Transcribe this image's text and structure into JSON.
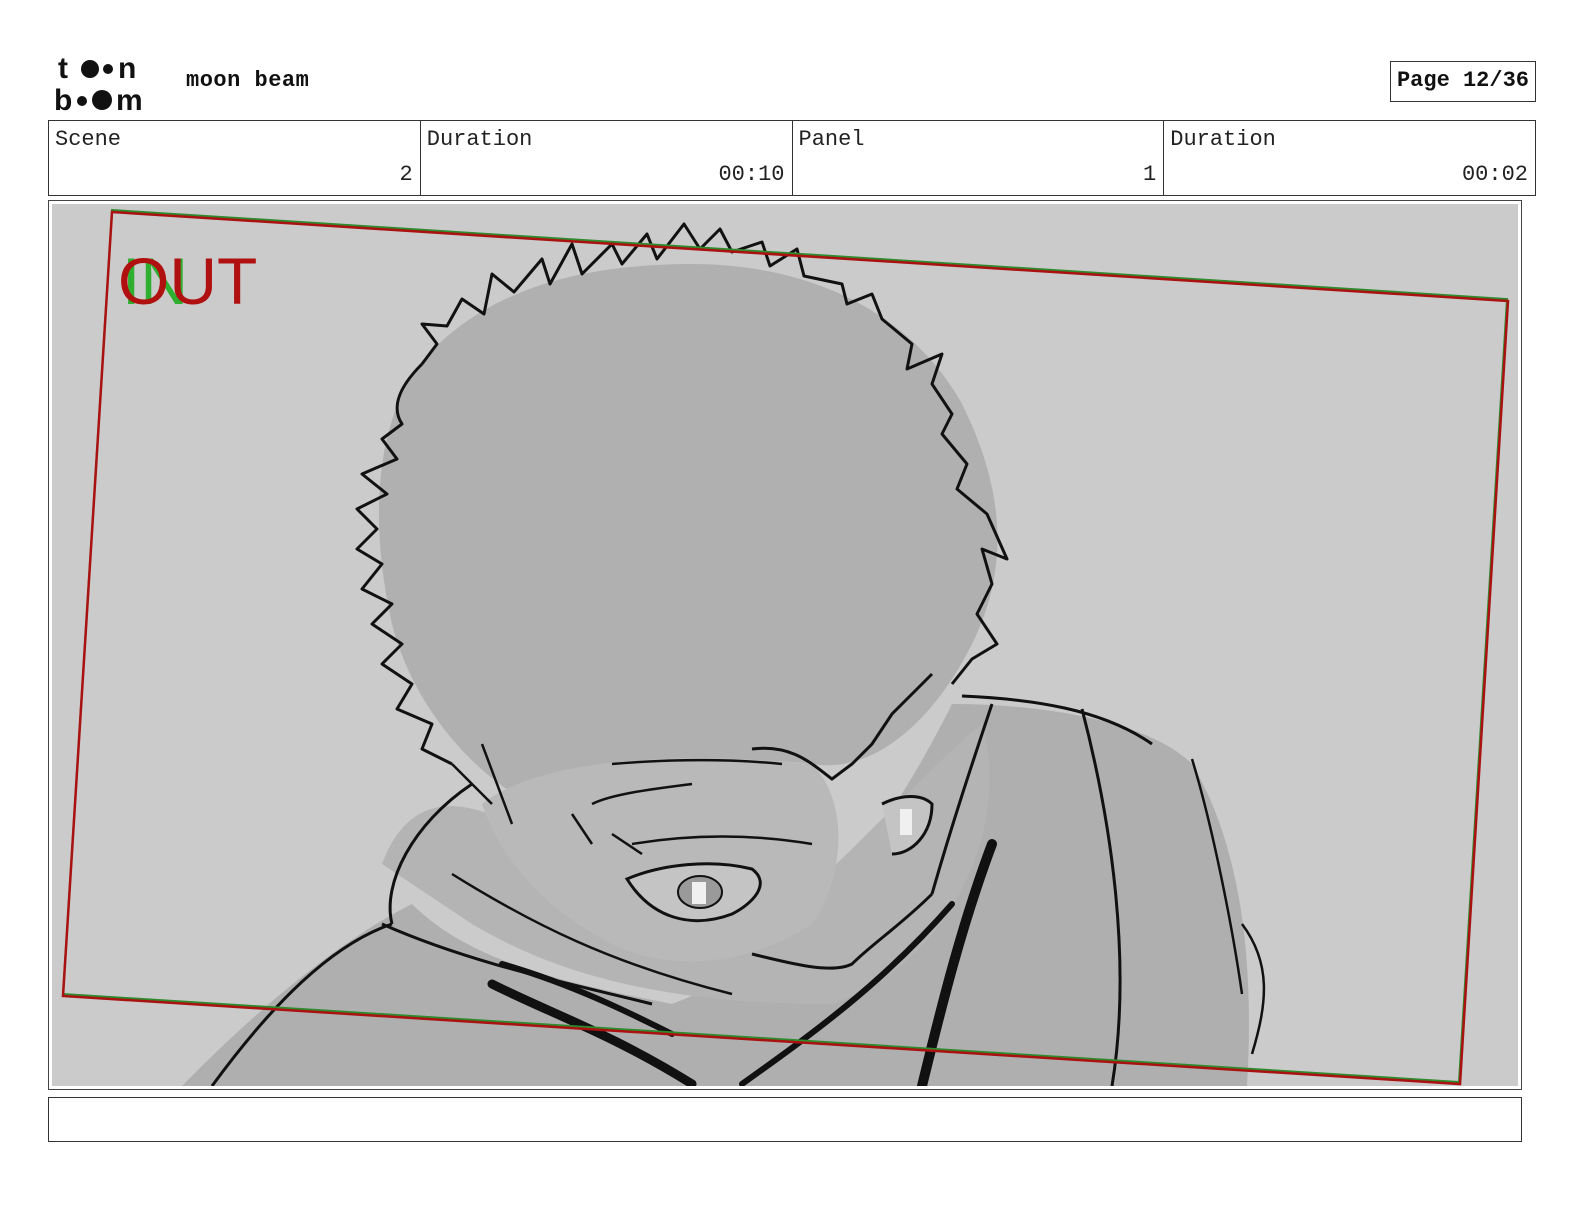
{
  "brand": {
    "logo_line1": "toon",
    "logo_line2": "boom",
    "project_title": "moon beam"
  },
  "page": {
    "label": "Page 12/36"
  },
  "info": {
    "scene_label": "Scene",
    "scene_value": "2",
    "scene_duration_label": "Duration",
    "scene_duration_value": "00:10",
    "panel_label": "Panel",
    "panel_value": "1",
    "panel_duration_label": "Duration",
    "panel_duration_value": "00:02"
  },
  "panel": {
    "in_marker": "IN",
    "out_marker": "OUT",
    "in_color": "#2fae2f",
    "out_color": "#b01010",
    "background_color": "#cbcbcb",
    "fill_color": "#afafaf"
  },
  "caption": {
    "text": ""
  }
}
